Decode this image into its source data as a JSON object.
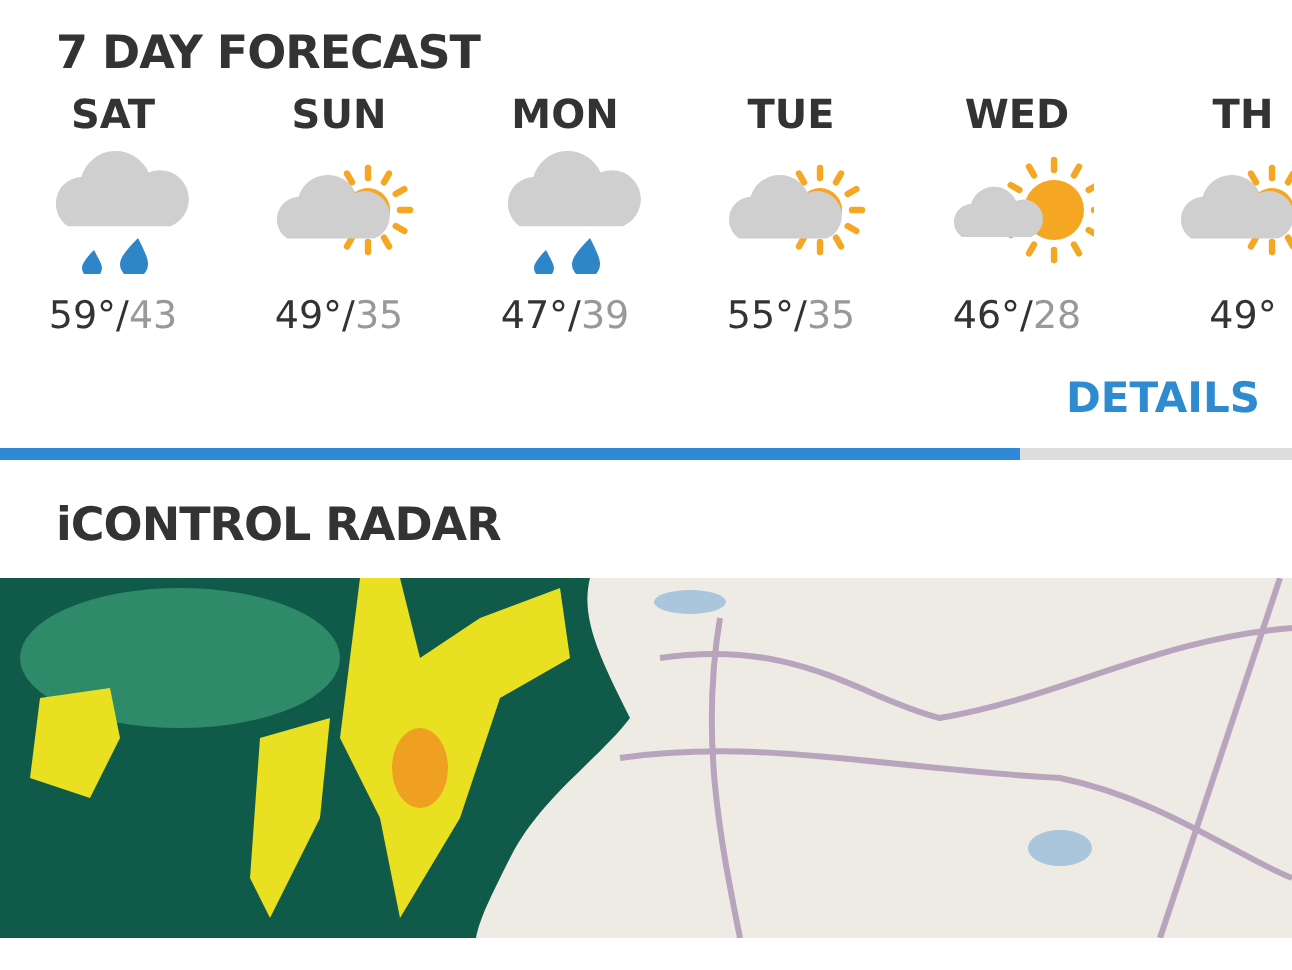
{
  "forecast": {
    "title": "7 DAY FORECAST",
    "days": [
      {
        "day": "SAT",
        "kind": "rain",
        "high": "59°/",
        "low": "43"
      },
      {
        "day": "SUN",
        "kind": "partly_sunny",
        "high": "49°/",
        "low": "35"
      },
      {
        "day": "MON",
        "kind": "rain",
        "high": "47°/",
        "low": "39"
      },
      {
        "day": "TUE",
        "kind": "partly_sunny",
        "high": "55°/",
        "low": "35"
      },
      {
        "day": "WED",
        "kind": "mostly_sunny",
        "high": "46°/",
        "low": "28"
      },
      {
        "day": "TH",
        "kind": "partly_sunny",
        "high": "49°"
      }
    ],
    "details": "DETAILS"
  },
  "radar": {
    "title": "iCONTROL RADAR"
  }
}
